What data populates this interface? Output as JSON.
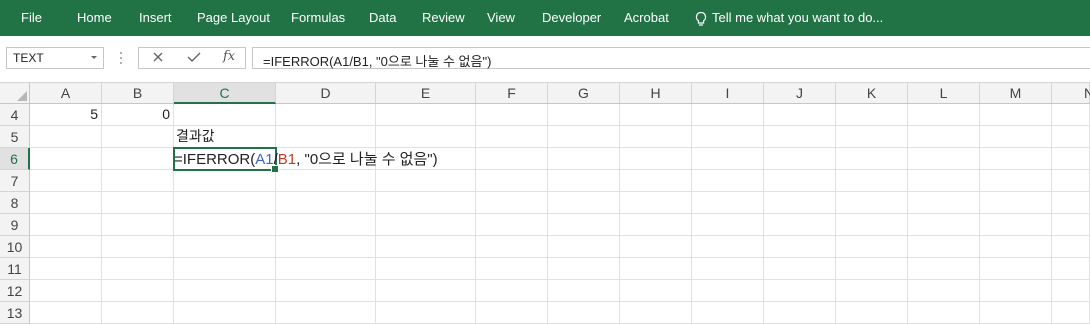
{
  "ribbon": {
    "tabs": [
      "File",
      "Home",
      "Insert",
      "Page Layout",
      "Formulas",
      "Data",
      "Review",
      "View",
      "Developer",
      "Acrobat"
    ],
    "tell_me": "Tell me what you want to do..."
  },
  "formula_bar": {
    "name_box": "TEXT",
    "fx_label": "fx",
    "formula": "=IFERROR(A1/B1, \"0으로 나눌 수 없음\")"
  },
  "columns": [
    "A",
    "B",
    "C",
    "D",
    "E",
    "F",
    "G",
    "H",
    "I",
    "J",
    "K",
    "L",
    "M",
    "N"
  ],
  "rows": [
    "4",
    "5",
    "6",
    "7",
    "8",
    "9",
    "10",
    "11",
    "12",
    "13"
  ],
  "cells": {
    "A4": "5",
    "B4": "0",
    "C5": "결과값"
  },
  "editing": {
    "prefix": "=IFERROR(",
    "ref1": "A1",
    "slash": "/",
    "ref2": "B1",
    "suffix": ", \"0으로 나눌 수 없음\")"
  },
  "colors": {
    "ribbon": "#217346",
    "ref1": "#3a66c4",
    "ref2": "#c0392b"
  }
}
